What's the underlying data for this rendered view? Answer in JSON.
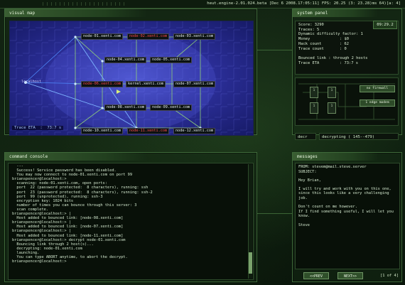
{
  "topbar": {
    "status": "heut.engine-2.01.024.beta [Dec  6 2008.17:05:11]  FPS: 20.25 (3: 23.28)ms  64)[a: 4]"
  },
  "visual_map": {
    "title": "visual map",
    "trace_label": "Trace ETA",
    "trace_value": "73:7 s",
    "localhost_label": "localhost",
    "nodes": [
      {
        "label": "node-01.xenti.com",
        "color": "white"
      },
      {
        "label": "node-02.xenti.com",
        "color": "red"
      },
      {
        "label": "node-03.xenti.com",
        "color": "white"
      },
      {
        "label": "node-04.xenti.com",
        "color": "white"
      },
      {
        "label": "node-05.xenti.com",
        "color": "white"
      },
      {
        "label": "node-06.xenti.com",
        "color": "red"
      },
      {
        "label": "kernel.xenti.com",
        "color": "white"
      },
      {
        "label": "node-07.xenti.com",
        "color": "white"
      },
      {
        "label": "node-08.xenti.com",
        "color": "white"
      },
      {
        "label": "node-09.xenti.com",
        "color": "white"
      },
      {
        "label": "node-10.xenti.com",
        "color": "white"
      },
      {
        "label": "node-11.xenti.com",
        "color": "red"
      },
      {
        "label": "node-12.xenti.com",
        "color": "white"
      }
    ]
  },
  "system_panel": {
    "title": "system panel",
    "clock": "09:29.2",
    "stats": [
      {
        "k": "Score: 3290",
        "v": ""
      },
      {
        "k": "Traces: 5",
        "v": ""
      },
      {
        "k": "Dynamic difficulty factor: 1",
        "v": ""
      },
      {
        "k": "Money",
        "v": ": $0"
      },
      {
        "k": "Hack count",
        "v": ": 62"
      },
      {
        "k": "Trace count",
        "v": ": 0"
      },
      {
        "k": "",
        "v": ""
      },
      {
        "k": "Bounced link : through 2 hosts",
        "v": ""
      },
      {
        "k": "Trace ETA",
        "v": ": 73:7 s"
      }
    ],
    "hw_buttons": [
      "no firewall",
      "1 edge modem"
    ],
    "chips": [
      "1",
      "1",
      "1",
      "1"
    ],
    "decr_label": "decr",
    "decr_status": "decrypting ( 145--479)"
  },
  "command_console": {
    "title": "command console",
    "lines": [
      "  ---",
      "  Success! Service password has been disabled.",
      "  You may now connect to node-01.xenti.com on port 99",
      "brianspencer@localhost:> ",
      "  scanning: node-01.xenti.com, open ports:",
      "  port  22 (password protected:  8 characters), running: ssh",
      "  port  23 (password protected:  8 characters), running: ssh-2",
      "  port  99 (unprotected), running: ssh-3",
      "  encryption key: 1024 bits",
      "  number of times you can bounce through this server: 3",
      "  scan complete.",
      "brianspencer@localhost:> |",
      "  Host added to bounced link: [node-08.xenti.com]",
      "brianspencer@localhost:> |",
      "  Host added to bounced link: [node-07.xenti.com]",
      "brianspencer@localhost:> |",
      "  Host added to bounced link: [node-11.xenti.com]",
      "brianspencer@localhost:> decrypt node-01.xenti.com",
      "  Bouncing link through 2 host(s)...",
      "  decrypting: node-01.xenti.com",
      "  launching.",
      "  You can type ABORT anytime, to abort the decrypt.",
      "brianspencer@localhost:> "
    ]
  },
  "messages": {
    "title": "messages",
    "from": "FROM: stevem@mail.steve.server",
    "subject": "SUBJECT:",
    "body": "Hey Brian,\n\nI will try and work with you on this one, since this looks like a very challenging job.\n\nDon't count on me however.\nIf I find something useful, I will let you know.\n\nSteve",
    "prev_label": "<<PREV",
    "next_label": "NEXT>>",
    "page_indicator": "[1 of 4]"
  }
}
